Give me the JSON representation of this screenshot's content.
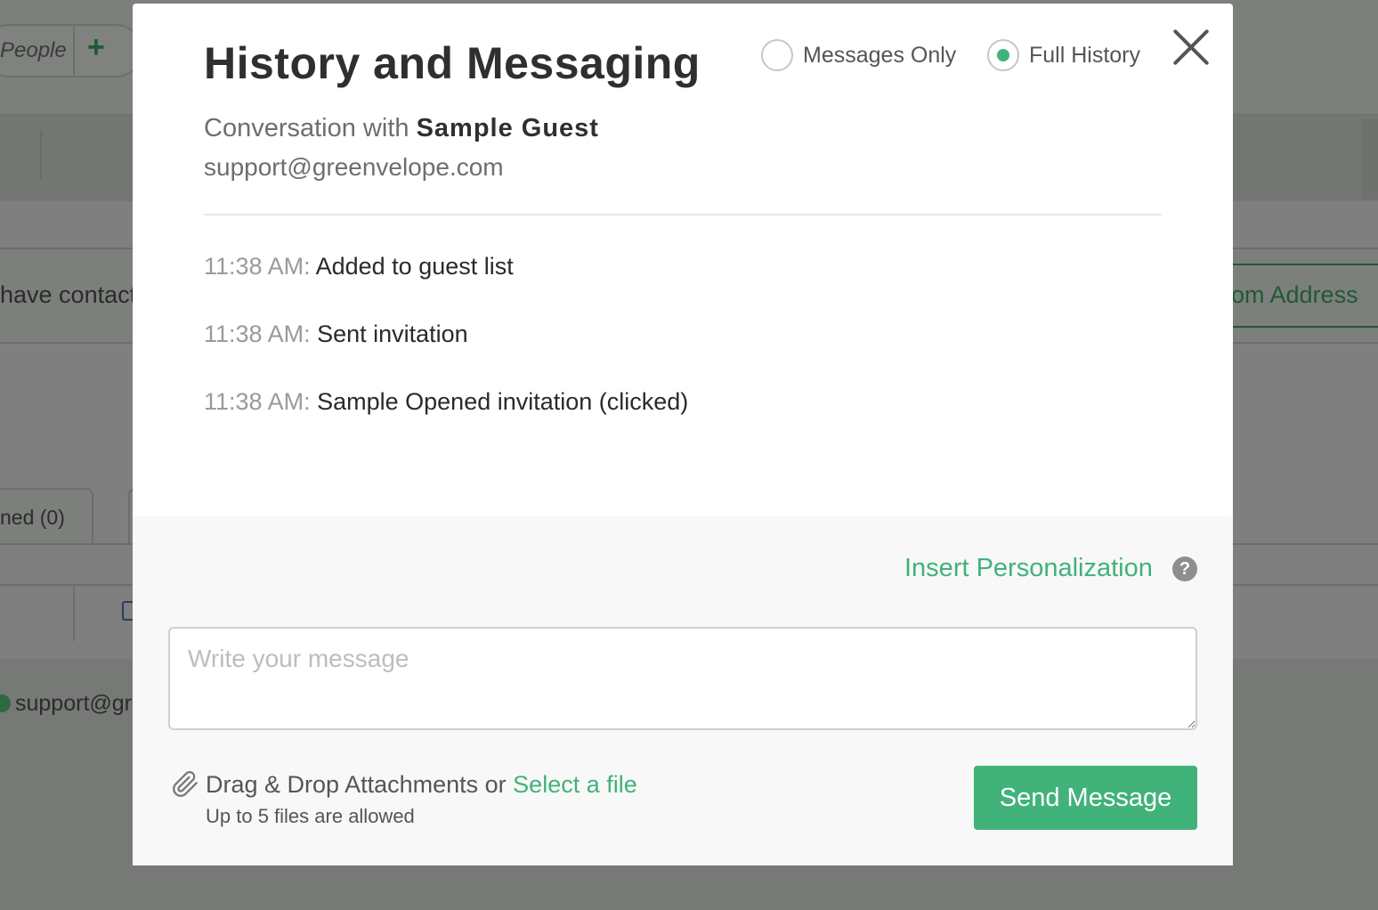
{
  "background_page": {
    "people_tab_label": "People",
    "add_icon": "plus-icon",
    "contacts_text": "have contacts",
    "custom_address_button": "om Address",
    "tab_label": "ned (0)",
    "sender_email_fragment": "support@gr"
  },
  "modal": {
    "title": "History and Messaging",
    "filters": [
      {
        "label": "Messages Only",
        "checked": false
      },
      {
        "label": "Full History",
        "checked": true
      }
    ],
    "close_icon": "close-icon",
    "conversation_prefix": "Conversation with",
    "guest_name": "Sample Guest",
    "guest_email": "support@greenvelope.com",
    "history": [
      {
        "time": "11:38 AM:",
        "text": "Added to guest list"
      },
      {
        "time": "11:38 AM:",
        "text": "Sent invitation"
      },
      {
        "time": "11:38 AM:",
        "text": "Sample Opened invitation (clicked)"
      }
    ],
    "composer": {
      "insert_personalization": "Insert Personalization",
      "help_icon": "question-circle-icon",
      "help_glyph": "?",
      "message_placeholder": "Write your message",
      "message_value": "",
      "attachment_icon": "paperclip-icon",
      "attach_prefix": "Drag & Drop Attachments or",
      "select_file": "Select a file",
      "attach_limit": "Up to 5 files are allowed",
      "send_button": "Send Message"
    }
  },
  "colors": {
    "accent_green": "#41b27a",
    "overlay": "#7e7f7e"
  }
}
